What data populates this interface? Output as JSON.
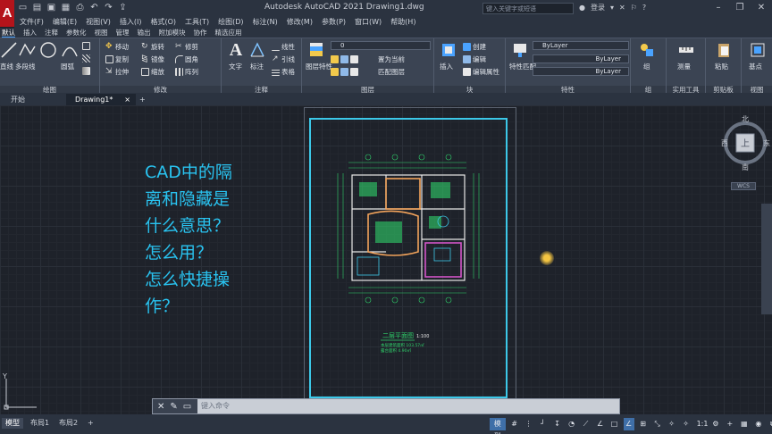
{
  "titlebar": {
    "logo": "A",
    "title": "Autodesk AutoCAD 2021    Drawing1.dwg",
    "search_placeholder": "键入关键字或短语",
    "login": "登录",
    "share_icon": "▸",
    "help": "?"
  },
  "menu": [
    "文件(F)",
    "编辑(E)",
    "视图(V)",
    "插入(I)",
    "格式(O)",
    "工具(T)",
    "绘图(D)",
    "标注(N)",
    "修改(M)",
    "参数(P)",
    "窗口(W)",
    "帮助(H)"
  ],
  "ribbon_tabs": [
    {
      "label": "默认",
      "active": true
    },
    {
      "label": "插入",
      "active": false
    },
    {
      "label": "注释",
      "active": false
    },
    {
      "label": "参数化",
      "active": false
    },
    {
      "label": "视图",
      "active": false
    },
    {
      "label": "管理",
      "active": false
    },
    {
      "label": "输出",
      "active": false
    },
    {
      "label": "附加模块",
      "active": false
    },
    {
      "label": "协作",
      "active": false
    },
    {
      "label": "精选应用",
      "active": false
    }
  ],
  "panels": {
    "draw": {
      "title": "绘图",
      "line": "直线",
      "polyline": "多段线",
      "circle": "圆",
      "arc": "圆弧"
    },
    "modify": {
      "title": "修改",
      "move": "移动",
      "rotate": "旋转",
      "trim": "修剪",
      "copy": "复制",
      "mirror": "镜像",
      "fillet": "圆角",
      "stretch": "拉伸",
      "scale": "缩放",
      "array": "阵列"
    },
    "annotation": {
      "title": "注释",
      "text": "文字",
      "dimension": "标注",
      "linear": "线性",
      "leader": "引线",
      "table": "表格"
    },
    "layers": {
      "title": "图层",
      "layer_props": "图层特性",
      "layer_current": "0",
      "set_current": "置为当前",
      "match_layer": "匹配图层"
    },
    "block": {
      "title": "块",
      "insert": "插入",
      "create": "创建",
      "edit": "编辑",
      "edit_attr": "编辑属性"
    },
    "properties": {
      "title": "特性",
      "match": "特性匹配",
      "color": "ByLayer",
      "linetype": "ByLayer",
      "lineweight": "ByLayer"
    },
    "groups": {
      "title": "组",
      "group": "组"
    },
    "utilities": {
      "title": "实用工具",
      "measure": "测量"
    },
    "clipboard": {
      "title": "剪贴板",
      "paste": "粘贴"
    },
    "view": {
      "title": "视图",
      "base": "基点"
    }
  },
  "file_tabs": [
    {
      "label": "开始",
      "active": false
    },
    {
      "label": "Drawing1*",
      "active": true,
      "close": "×"
    },
    {
      "label": "+",
      "active": false
    }
  ],
  "overlay_lines": [
    "CAD中的隔",
    "离和隐藏是",
    "什么意思？",
    "怎么用？",
    "怎么快捷操",
    "作？"
  ],
  "drawing": {
    "plan_title": "二层平面图",
    "plan_scale": "1:100",
    "note1": "本层建筑面积 103.57㎡",
    "note2": "露台面积 4.90㎡"
  },
  "viewcube": {
    "north": "北",
    "south": "南",
    "east": "东",
    "west": "西",
    "top": "上",
    "wcs": "WCS"
  },
  "ucs": {
    "y_label": "Y"
  },
  "command": {
    "placeholder": "键入命令"
  },
  "status": {
    "tabs": [
      {
        "label": "模型",
        "active": true
      },
      {
        "label": "布局1",
        "active": false
      },
      {
        "label": "布局2",
        "active": false
      },
      {
        "label": "+",
        "active": false
      }
    ],
    "model_label": "模型",
    "scale": "1:1"
  }
}
